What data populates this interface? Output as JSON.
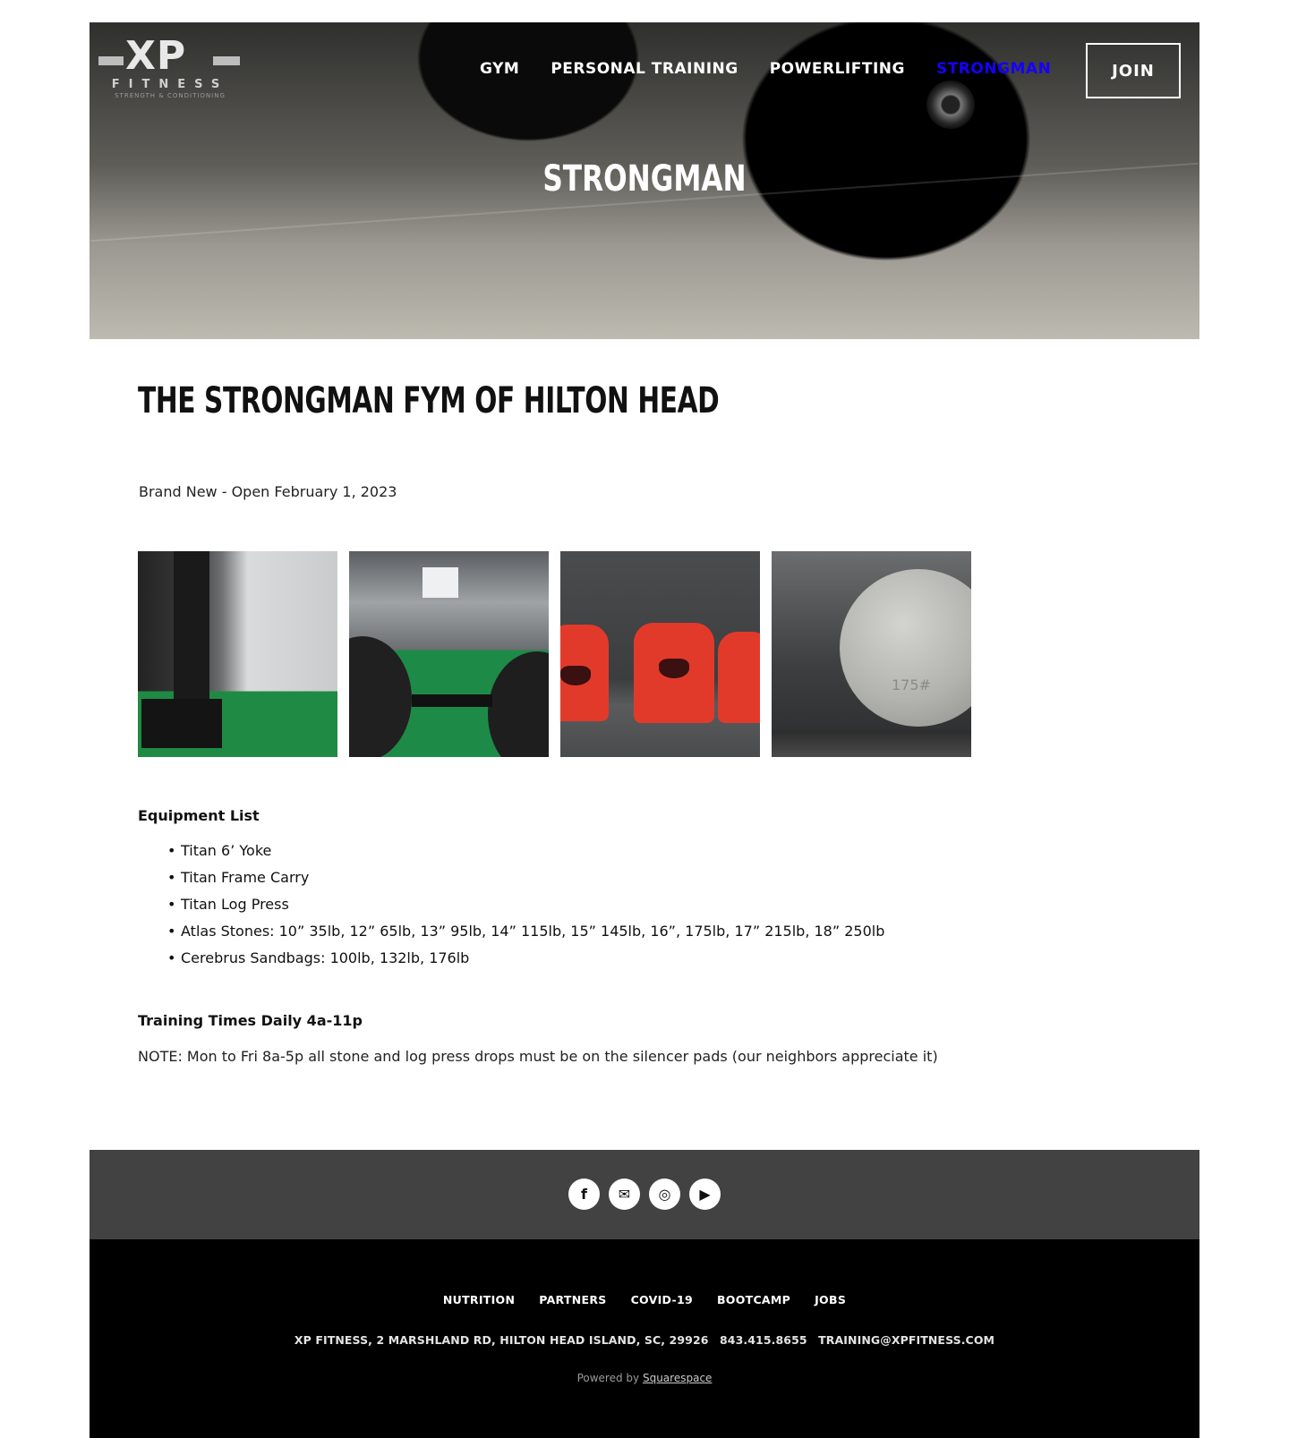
{
  "header": {
    "logo": {
      "mark": "XP",
      "wordmark": "FITNESS",
      "tagline": "STRENGTH & CONDITIONING"
    },
    "nav": [
      {
        "label": "GYM"
      },
      {
        "label": "PERSONAL TRAINING"
      },
      {
        "label": "POWERLIFTING"
      },
      {
        "label": "STRONGMAN",
        "active": true
      }
    ],
    "join_label": "JOIN",
    "active_color": "#1600ff",
    "hero_title": "STRONGMAN"
  },
  "main": {
    "heading": "THE STRONGMAN FYM OF HILTON HEAD",
    "subline": "Brand New - Open February 1, 2023",
    "gallery": [
      {
        "alt": "equipment-rack-photo"
      },
      {
        "alt": "yoke-on-turf-photo"
      },
      {
        "alt": "sandbags-photo"
      },
      {
        "alt": "atlas-stone-photo",
        "label": "175#"
      }
    ],
    "equipment_title": "Equipment List",
    "equipment": [
      "Titan 6’ Yoke",
      "Titan Frame Carry",
      "Titan Log Press",
      "Atlas Stones: 10” 35lb, 12” 65lb, 13” 95lb, 14” 115lb, 15” 145lb, 16”, 175lb, 17” 215lb, 18” 250lb",
      "Cerebrus Sandbags: 100lb, 132lb, 176lb"
    ],
    "times_title": "Training Times Daily 4a-11p",
    "note": "NOTE: Mon to Fri 8a-5p all stone and log press drops must be on the silencer pads (our neighbors appreciate it)"
  },
  "footer": {
    "social": [
      {
        "icon": "facebook-icon",
        "glyph": "f"
      },
      {
        "icon": "email-icon",
        "glyph": "✉"
      },
      {
        "icon": "instagram-icon",
        "glyph": "◎"
      },
      {
        "icon": "youtube-icon",
        "glyph": "▶"
      }
    ],
    "links": [
      "NUTRITION",
      "PARTNERS",
      "COVID-19",
      "BOOTCAMP",
      "JOBS"
    ],
    "address": "XP FITNESS, 2 MARSHLAND RD, HILTON HEAD ISLAND, SC, 29926",
    "phone": "843.415.8655",
    "email": "TRAINING@XPFITNESS.COM",
    "powered_prefix": "Powered by",
    "powered_link": "Squarespace"
  }
}
